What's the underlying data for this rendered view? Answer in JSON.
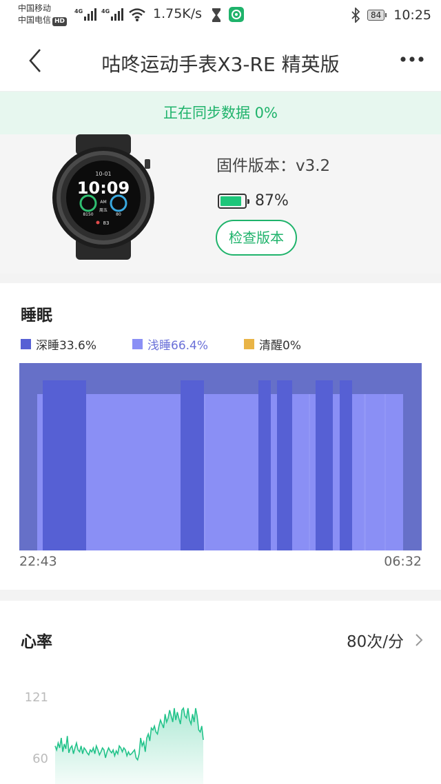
{
  "status_bar": {
    "carrier1": "中国移动",
    "carrier2": "中国电信",
    "hd_badge": "HD",
    "net1": "4G",
    "net2": "4G",
    "speed": "1.75K/s",
    "battery": "84",
    "time": "10:25"
  },
  "header": {
    "title": "咕咚运动手表X3-RE 精英版"
  },
  "sync": {
    "text": "正在同步数据 0%"
  },
  "device": {
    "watch_face": {
      "date": "10-01",
      "time": "10:09",
      "ampm": "AM",
      "steps": "8150",
      "hr": "80",
      "weekday": "周五",
      "heart": "83"
    },
    "firmware": "固件版本：v3.2",
    "battery_pct": "87%",
    "battery_fraction": 0.87,
    "check_button": "检查版本"
  },
  "sleep": {
    "title": "睡眠",
    "legend": [
      {
        "label": "深睡33.6%",
        "color": "#5660d4"
      },
      {
        "label": "浅睡66.4%",
        "color": "#8a8ff5"
      },
      {
        "label": "清醒0%",
        "color": "#e9b446"
      }
    ],
    "start_time": "22:43",
    "end_time": "06:32",
    "colors": {
      "background": "#6670c8",
      "deep": "#5660d4",
      "light": "#8a8ff5"
    }
  },
  "chart_data": {
    "type": "area",
    "title": "心率",
    "xlabel": "",
    "ylabel": "",
    "yticks": [
      121,
      60
    ],
    "ylim": [
      50,
      130
    ],
    "series": [
      {
        "values": [
          72,
          68,
          75,
          70,
          80,
          66,
          74,
          69,
          82,
          65,
          70,
          72,
          64,
          70,
          75,
          68,
          66,
          72,
          64,
          70,
          68,
          65,
          63,
          68,
          66,
          70,
          64,
          72,
          68,
          63,
          66,
          70,
          68,
          60,
          66,
          70,
          67,
          65,
          68,
          62,
          67,
          64,
          72,
          70,
          66,
          70,
          68,
          62,
          66,
          63,
          64,
          66,
          68,
          60,
          58,
          64,
          80,
          72,
          76,
          66,
          80,
          84,
          77,
          90,
          88,
          92,
          86,
          84,
          92,
          98,
          94,
          90,
          104,
          96,
          100,
          108,
          102,
          96,
          110,
          98,
          106,
          100,
          94,
          108,
          110,
          102,
          100,
          110,
          98,
          94,
          104,
          96,
          110,
          102,
          88,
          86,
          92,
          78
        ]
      }
    ],
    "color": "#22c38a"
  },
  "heart": {
    "title": "心率",
    "value": "80次/分",
    "y_top": "121",
    "y_bottom": "60"
  }
}
